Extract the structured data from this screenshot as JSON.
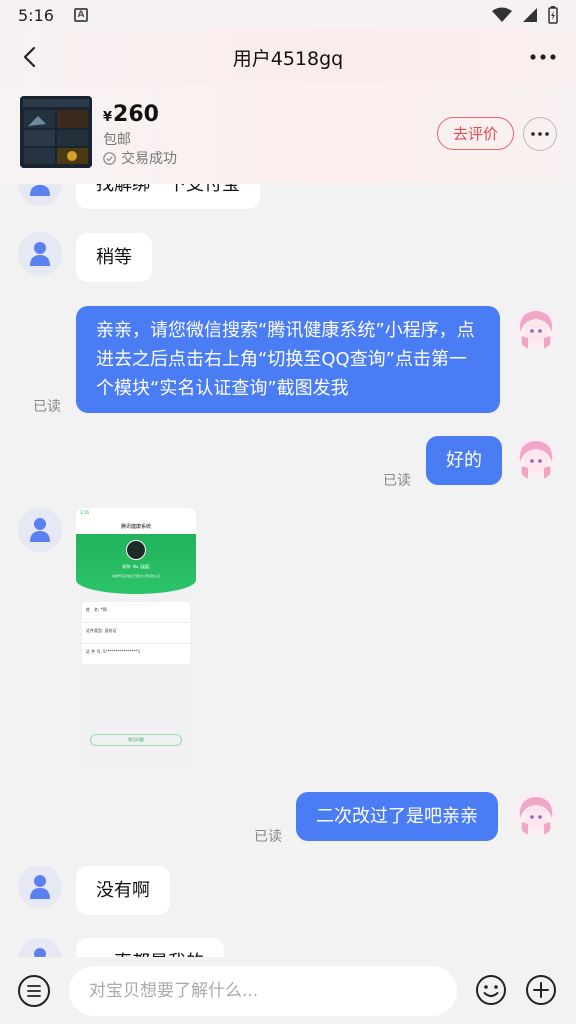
{
  "status_bar": {
    "time": "5:16",
    "app_icon": "A"
  },
  "header": {
    "title": "用户4518gq",
    "back_icon": "chevron-left-icon",
    "more_icon": "more-horizontal-icon"
  },
  "product": {
    "price_symbol": "¥",
    "price": "260",
    "shipping": "包邮",
    "status": "交易成功",
    "review_button": "去评价"
  },
  "messages": [
    {
      "from": "seller",
      "text": "找解绑一下支付宝"
    },
    {
      "from": "seller",
      "text": "稍等"
    },
    {
      "from": "me",
      "text": "亲亲，请您微信搜索“腾讯健康系统”小程序，点进去之后点击右上角“切换至QQ查询”点击第一个模块“实名认证查询”截图发我",
      "read": "已读"
    },
    {
      "from": "me",
      "text": "好的",
      "read": "已读"
    },
    {
      "from": "seller",
      "type": "image"
    },
    {
      "from": "me",
      "text": "二次改过了是吧亲亲",
      "read": "已读"
    },
    {
      "from": "seller",
      "text": "没有啊"
    },
    {
      "from": "seller",
      "text": "一直都是我的"
    }
  ],
  "screenshot_message": {
    "time": "3:16",
    "title": "腾讯健康系统",
    "nickname_label": "昵称:",
    "nickname": "Na",
    "badge": "认证",
    "caption": "本账号实名信息已通过公安系统认证",
    "rows": [
      {
        "label": "姓　名:",
        "value": "*锦"
      },
      {
        "label": "证件类型:",
        "value": "身份证"
      },
      {
        "label": "证 件 号:",
        "value": "5****************1"
      }
    ],
    "button": "常见问题"
  },
  "input": {
    "placeholder": "对宝贝想要了解什么..."
  },
  "colors": {
    "outgoing_bubble": "#4a7cf4",
    "review_accent": "#e14b52",
    "screenshot_green": "#22b35a"
  }
}
